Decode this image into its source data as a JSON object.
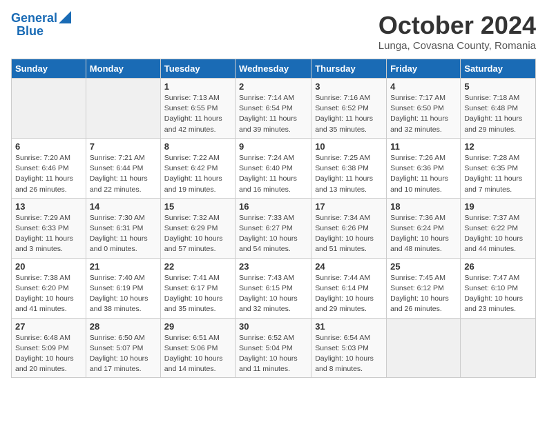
{
  "logo": {
    "line1": "General",
    "line2": "Blue"
  },
  "title": "October 2024",
  "subtitle": "Lunga, Covasna County, Romania",
  "weekdays": [
    "Sunday",
    "Monday",
    "Tuesday",
    "Wednesday",
    "Thursday",
    "Friday",
    "Saturday"
  ],
  "weeks": [
    [
      null,
      null,
      {
        "day": 1,
        "sunrise": "7:13 AM",
        "sunset": "6:55 PM",
        "daylight": "11 hours and 42 minutes."
      },
      {
        "day": 2,
        "sunrise": "7:14 AM",
        "sunset": "6:54 PM",
        "daylight": "11 hours and 39 minutes."
      },
      {
        "day": 3,
        "sunrise": "7:16 AM",
        "sunset": "6:52 PM",
        "daylight": "11 hours and 35 minutes."
      },
      {
        "day": 4,
        "sunrise": "7:17 AM",
        "sunset": "6:50 PM",
        "daylight": "11 hours and 32 minutes."
      },
      {
        "day": 5,
        "sunrise": "7:18 AM",
        "sunset": "6:48 PM",
        "daylight": "11 hours and 29 minutes."
      }
    ],
    [
      {
        "day": 6,
        "sunrise": "7:20 AM",
        "sunset": "6:46 PM",
        "daylight": "11 hours and 26 minutes."
      },
      {
        "day": 7,
        "sunrise": "7:21 AM",
        "sunset": "6:44 PM",
        "daylight": "11 hours and 22 minutes."
      },
      {
        "day": 8,
        "sunrise": "7:22 AM",
        "sunset": "6:42 PM",
        "daylight": "11 hours and 19 minutes."
      },
      {
        "day": 9,
        "sunrise": "7:24 AM",
        "sunset": "6:40 PM",
        "daylight": "11 hours and 16 minutes."
      },
      {
        "day": 10,
        "sunrise": "7:25 AM",
        "sunset": "6:38 PM",
        "daylight": "11 hours and 13 minutes."
      },
      {
        "day": 11,
        "sunrise": "7:26 AM",
        "sunset": "6:36 PM",
        "daylight": "11 hours and 10 minutes."
      },
      {
        "day": 12,
        "sunrise": "7:28 AM",
        "sunset": "6:35 PM",
        "daylight": "11 hours and 7 minutes."
      }
    ],
    [
      {
        "day": 13,
        "sunrise": "7:29 AM",
        "sunset": "6:33 PM",
        "daylight": "11 hours and 3 minutes."
      },
      {
        "day": 14,
        "sunrise": "7:30 AM",
        "sunset": "6:31 PM",
        "daylight": "11 hours and 0 minutes."
      },
      {
        "day": 15,
        "sunrise": "7:32 AM",
        "sunset": "6:29 PM",
        "daylight": "10 hours and 57 minutes."
      },
      {
        "day": 16,
        "sunrise": "7:33 AM",
        "sunset": "6:27 PM",
        "daylight": "10 hours and 54 minutes."
      },
      {
        "day": 17,
        "sunrise": "7:34 AM",
        "sunset": "6:26 PM",
        "daylight": "10 hours and 51 minutes."
      },
      {
        "day": 18,
        "sunrise": "7:36 AM",
        "sunset": "6:24 PM",
        "daylight": "10 hours and 48 minutes."
      },
      {
        "day": 19,
        "sunrise": "7:37 AM",
        "sunset": "6:22 PM",
        "daylight": "10 hours and 44 minutes."
      }
    ],
    [
      {
        "day": 20,
        "sunrise": "7:38 AM",
        "sunset": "6:20 PM",
        "daylight": "10 hours and 41 minutes."
      },
      {
        "day": 21,
        "sunrise": "7:40 AM",
        "sunset": "6:19 PM",
        "daylight": "10 hours and 38 minutes."
      },
      {
        "day": 22,
        "sunrise": "7:41 AM",
        "sunset": "6:17 PM",
        "daylight": "10 hours and 35 minutes."
      },
      {
        "day": 23,
        "sunrise": "7:43 AM",
        "sunset": "6:15 PM",
        "daylight": "10 hours and 32 minutes."
      },
      {
        "day": 24,
        "sunrise": "7:44 AM",
        "sunset": "6:14 PM",
        "daylight": "10 hours and 29 minutes."
      },
      {
        "day": 25,
        "sunrise": "7:45 AM",
        "sunset": "6:12 PM",
        "daylight": "10 hours and 26 minutes."
      },
      {
        "day": 26,
        "sunrise": "7:47 AM",
        "sunset": "6:10 PM",
        "daylight": "10 hours and 23 minutes."
      }
    ],
    [
      {
        "day": 27,
        "sunrise": "6:48 AM",
        "sunset": "5:09 PM",
        "daylight": "10 hours and 20 minutes."
      },
      {
        "day": 28,
        "sunrise": "6:50 AM",
        "sunset": "5:07 PM",
        "daylight": "10 hours and 17 minutes."
      },
      {
        "day": 29,
        "sunrise": "6:51 AM",
        "sunset": "5:06 PM",
        "daylight": "10 hours and 14 minutes."
      },
      {
        "day": 30,
        "sunrise": "6:52 AM",
        "sunset": "5:04 PM",
        "daylight": "10 hours and 11 minutes."
      },
      {
        "day": 31,
        "sunrise": "6:54 AM",
        "sunset": "5:03 PM",
        "daylight": "10 hours and 8 minutes."
      },
      null,
      null
    ]
  ]
}
